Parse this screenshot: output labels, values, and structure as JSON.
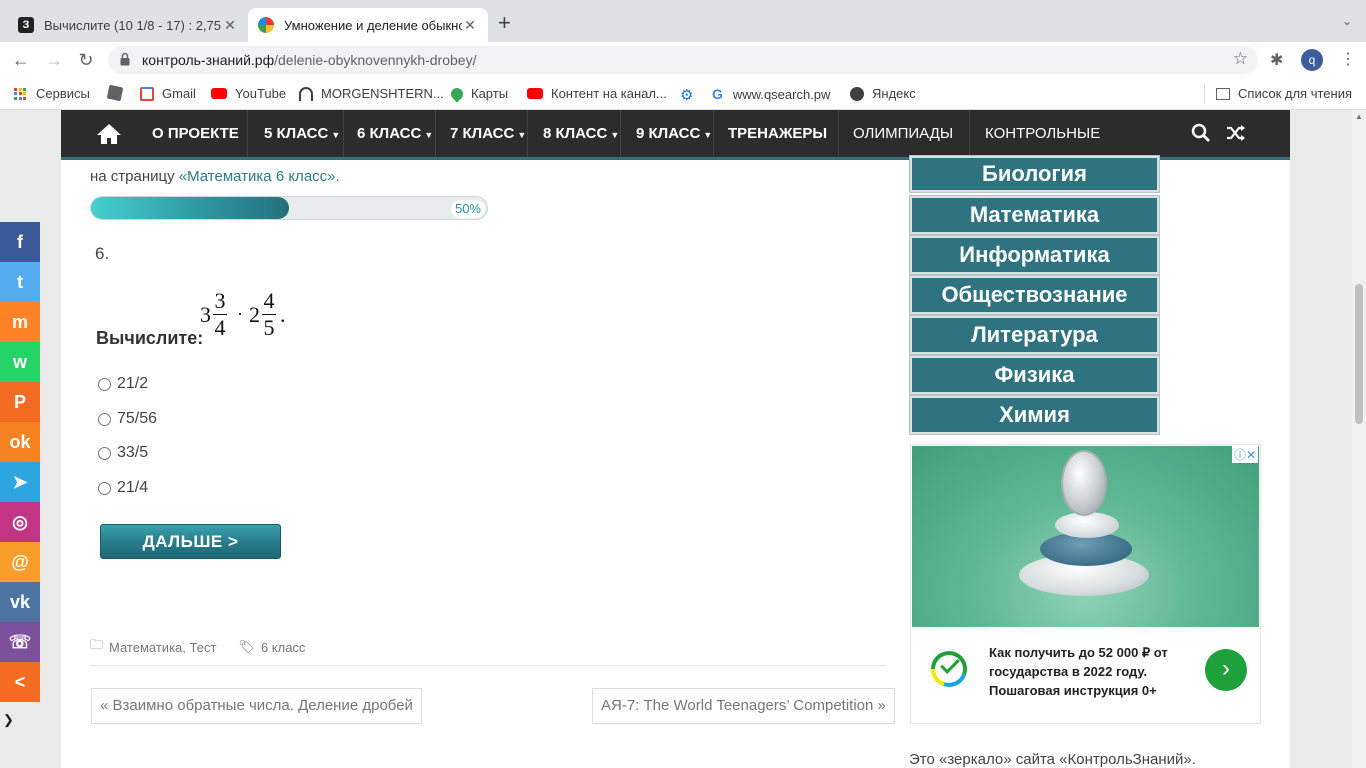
{
  "browser": {
    "tabs": [
      {
        "title": "Вычислите (10 1/8 - 17) : 2,75",
        "favicon": "З",
        "active": false
      },
      {
        "title": "Умножение и деление обыкно",
        "favicon": "",
        "active": true
      }
    ],
    "url_host": "контроль-знаний.рф",
    "url_path": "/delenie-obyknovennykh-drobey/",
    "profile_initial": "q",
    "bookmarks": [
      {
        "label": "Сервисы",
        "icon": "apps-icon"
      },
      {
        "label": "",
        "icon": "bookmark-icon"
      },
      {
        "label": "Gmail",
        "icon": "gmail-icon"
      },
      {
        "label": "YouTube",
        "icon": "youtube-icon"
      },
      {
        "label": "MORGENSHTERN...",
        "icon": "headphones-icon"
      },
      {
        "label": "Карты",
        "icon": "maps-icon"
      },
      {
        "label": "Контент на канал...",
        "icon": "youtube-icon"
      },
      {
        "label": "",
        "icon": "gear-icon"
      },
      {
        "label": "www.qsearch.pw",
        "icon": "google-icon"
      },
      {
        "label": "Яндекс",
        "icon": "globe-icon"
      }
    ],
    "reading_list": "Список для чтения"
  },
  "nav": {
    "items": [
      {
        "label": "О ПРОЕКТЕ",
        "caret": false
      },
      {
        "label": "5 КЛАСС",
        "caret": true
      },
      {
        "label": "6 КЛАСС",
        "caret": true
      },
      {
        "label": "7 КЛАСС",
        "caret": true
      },
      {
        "label": "8 КЛАСС",
        "caret": true
      },
      {
        "label": "9 КЛАСС",
        "caret": true
      },
      {
        "label": "ТРЕНАЖЕРЫ",
        "caret": false
      },
      {
        "label": "ОЛИМПИАДЫ",
        "caret": false
      },
      {
        "label": "КОНТРОЛЬНЫЕ",
        "caret": false
      }
    ],
    "caret_symbol": "▼"
  },
  "quiz": {
    "intro_prefix": "на страницу ",
    "intro_link": "«Математика 6 класс».",
    "progress_percent": 50,
    "progress_label": "50%",
    "question_number": "6.",
    "question_label": "Вычислите:",
    "formula": {
      "whole1": "3",
      "num1": "3",
      "den1": "4",
      "op": "·",
      "whole2": "2",
      "num2": "4",
      "den2": "5",
      "end": "."
    },
    "options": [
      "21/2",
      "75/56",
      "33/5",
      "21/4"
    ],
    "next_button": "ДАЛЬШЕ  >"
  },
  "post_meta": {
    "categories": [
      "Математика",
      "Тест"
    ],
    "tag": "6 класс",
    "prev_post": "Взаимно обратные числа. Деление дробей",
    "next_post": "АЯ-7: The World Teenagers’ Competition"
  },
  "sidebar": {
    "subjects": [
      "Биология",
      "Математика",
      "Информатика",
      "Обществознание",
      "Литература",
      "Физика",
      "Химия"
    ],
    "ad": {
      "text": "Как получить до 52 000 ₽ от государства в 2022 году. Пошаговая инструкция 0+"
    },
    "mirror_text": "Это «зеркало» сайта «КонтрольЗнаний»."
  },
  "social": [
    {
      "name": "facebook",
      "glyph": "f",
      "color": "#3b5998"
    },
    {
      "name": "twitter",
      "glyph": "t",
      "color": "#55acee"
    },
    {
      "name": "mix",
      "glyph": "m",
      "color": "#ff8226"
    },
    {
      "name": "whatsapp",
      "glyph": "w",
      "color": "#25d366"
    },
    {
      "name": "print",
      "glyph": "P",
      "color": "#f36c22"
    },
    {
      "name": "odnoklassniki",
      "glyph": "ok",
      "color": "#f58220"
    },
    {
      "name": "telegram",
      "glyph": "➤",
      "color": "#2ca5e0"
    },
    {
      "name": "instagram",
      "glyph": "◎",
      "color": "#c13584"
    },
    {
      "name": "mailru",
      "glyph": "@",
      "color": "#f99e2a"
    },
    {
      "name": "vk",
      "glyph": "vk",
      "color": "#4c75a3"
    },
    {
      "name": "viber",
      "glyph": "☏",
      "color": "#7b519d"
    },
    {
      "name": "share",
      "glyph": "<",
      "color": "#f36c22"
    }
  ]
}
